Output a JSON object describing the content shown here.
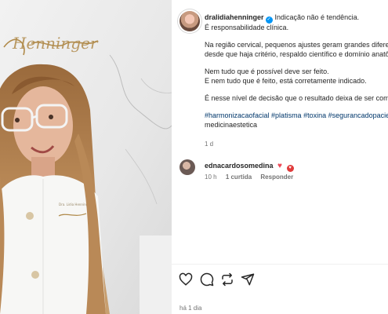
{
  "post": {
    "username": "dralidiahenninger",
    "caption_lines": [
      "Indicação não é tendência.",
      "É responsabilidade clínica.",
      "",
      "Na região cervical, pequenos ajustes geram grandes diferenças,",
      "desde que haja critério, respaldo científico e domínio anatômico.",
      "",
      "Nem tudo que é possível deve ser feito.",
      "E nem tudo que é feito, está corretamente indicado.",
      "",
      "É nesse nível de decisão que o resultado deixa de ser comum.",
      ""
    ],
    "hashtags_line1": "#harmonizacaofacial #platisma #toxina #segurancadopaciente",
    "hashtags_line2": "medicinaestetica",
    "time": "1 d"
  },
  "comment": {
    "username": "ednacardosomedina",
    "time": "10 h",
    "likes": "1 curtida",
    "reply": "Responder"
  },
  "footer": {
    "date": "há 1 dia"
  },
  "media": {
    "sign_text": "Henninger"
  },
  "colors": {
    "accent_link": "#00376b",
    "verified": "#0095f6",
    "heart": "#ed4956"
  }
}
